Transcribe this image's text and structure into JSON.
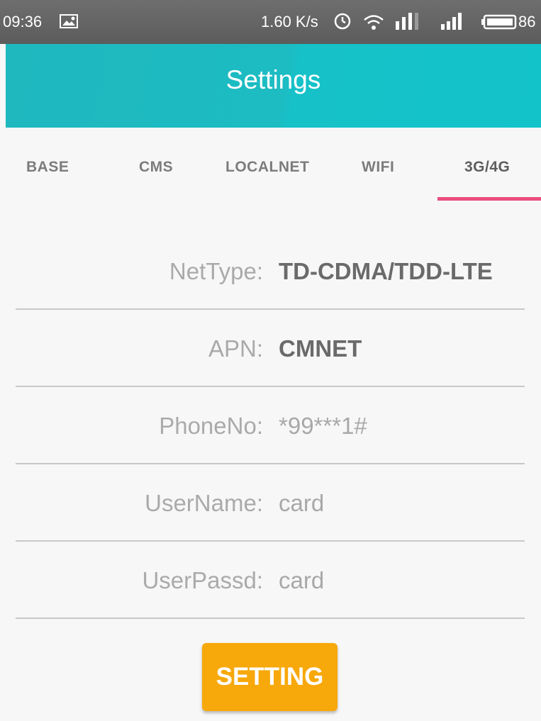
{
  "status_bar": {
    "time": "09:36",
    "net_speed": "1.60 K/s",
    "battery_percent": "86",
    "icons": [
      "photo-icon",
      "alarm-icon",
      "wifi-icon",
      "signal-icon",
      "signal-icon",
      "battery-icon"
    ]
  },
  "app_bar": {
    "title": "Settings",
    "color": "#1cbcc2"
  },
  "tabs": [
    {
      "label": "BASE"
    },
    {
      "label": "CMS"
    },
    {
      "label": "LOCALNET"
    },
    {
      "label": "WIFI"
    },
    {
      "label": "3G/4G",
      "active": true
    }
  ],
  "tab_indicator_color": "#ec4c7f",
  "form": {
    "net_type": {
      "label": "NetType:",
      "value": "TD-CDMA/TDD-LTE"
    },
    "apn": {
      "label": "APN:",
      "value": "CMNET"
    },
    "phone_no": {
      "label": "PhoneNo:",
      "value": "*99***1#"
    },
    "user_name": {
      "label": "UserName:",
      "value": "card"
    },
    "user_passd": {
      "label": "UserPassd:",
      "value": "card"
    }
  },
  "button": {
    "label": "SETTING",
    "color": "#f7a80a"
  }
}
